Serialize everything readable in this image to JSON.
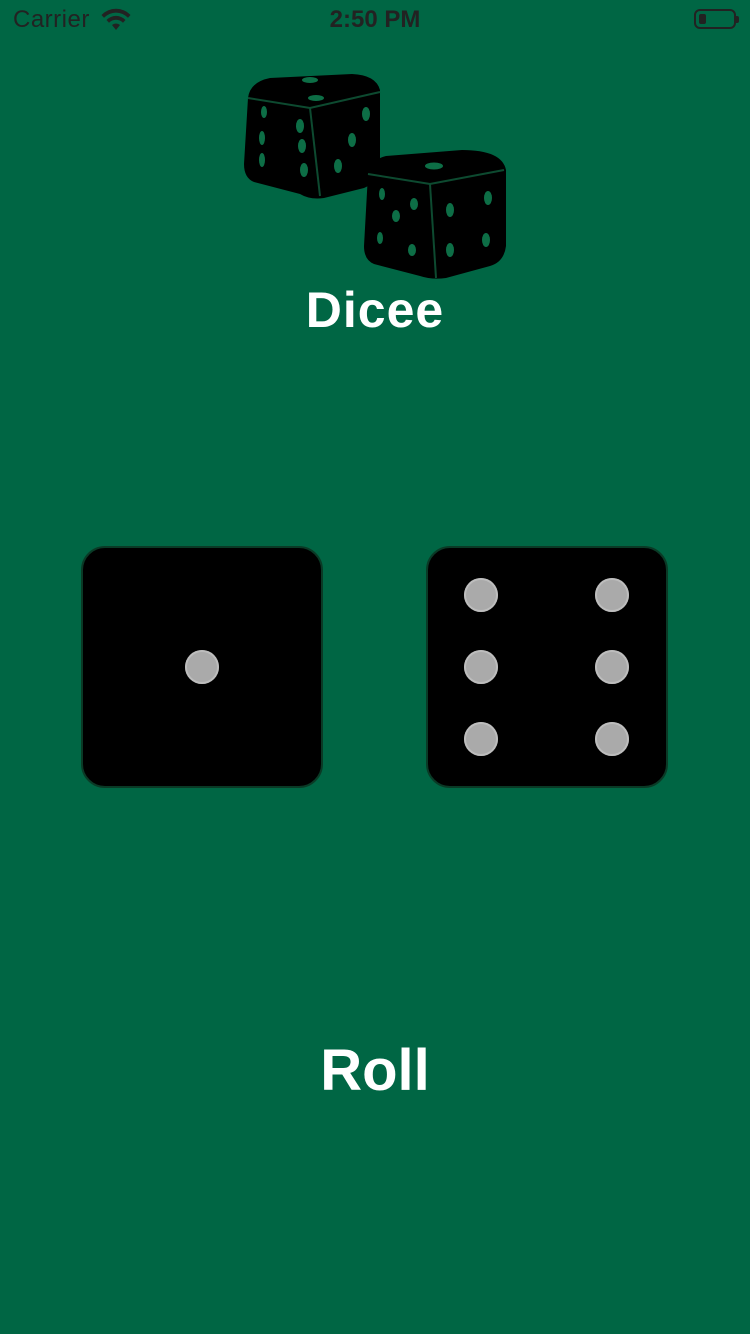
{
  "status_bar": {
    "carrier": "Carrier",
    "time": "2:50 PM",
    "wifi_icon": "wifi-icon",
    "battery_icon": "battery-icon"
  },
  "app": {
    "title": "Dicee",
    "logo_icon": "dice-pair-icon"
  },
  "dice": [
    {
      "value": 1
    },
    {
      "value": 6
    }
  ],
  "roll_button": {
    "label": "Roll"
  },
  "colors": {
    "background": "#006644",
    "die": "#000000",
    "pip": "#aaaaaa",
    "text": "#ffffff"
  }
}
